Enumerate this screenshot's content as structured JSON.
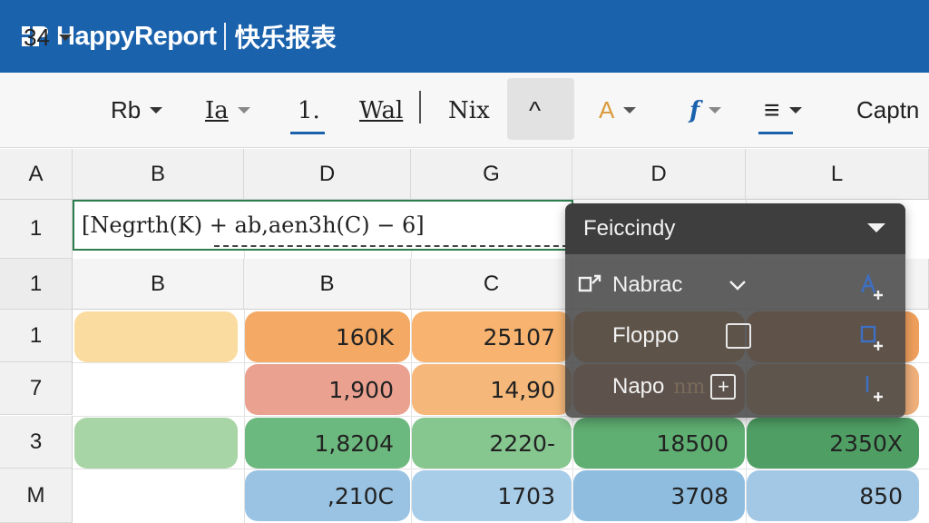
{
  "app": {
    "name": "HappyReport",
    "name_cn": "快乐报表"
  },
  "toolbar": {
    "font_size": "34",
    "font_name": "Rb",
    "style_a": "Ia",
    "style_b": "1.",
    "style_c": "Wal",
    "style_d": "Nix",
    "style_e": "^",
    "text_color": "A",
    "function": "f",
    "align": "≡",
    "caption": "Captn"
  },
  "columns": [
    "A",
    "B",
    "D",
    "G",
    "D",
    "L"
  ],
  "formula_row": {
    "row_label": "1",
    "formula": "[Negrth(K)  + ab,aen3h(C) − 6]"
  },
  "sub_header": {
    "row_label": "1",
    "labels": [
      "B",
      "B",
      "C"
    ]
  },
  "rows": [
    {
      "label": "1",
      "cells": [
        "",
        "160K",
        "25107",
        "",
        ""
      ]
    },
    {
      "label": "7",
      "cells": [
        "",
        "1,900",
        "14,90",
        "",
        ""
      ]
    },
    {
      "label": "3",
      "cells": [
        "",
        "1,8204",
        "2220-",
        "18500",
        "2350X"
      ]
    },
    {
      "label": "M",
      "cells": [
        "",
        ",210C",
        "1703",
        "3708",
        "850"
      ]
    }
  ],
  "dropdown": {
    "selected": "Feiccindy",
    "items": [
      {
        "label": "Nabrac"
      },
      {
        "label": "Floppo"
      },
      {
        "label": "Napo"
      }
    ],
    "background_text": "nm"
  },
  "colors": {
    "brand": "#1b62ad",
    "cell_yellow": "#fbdca0",
    "cell_orange": "#f4a964",
    "cell_red": "#eaa190",
    "cell_green_light": "#a8d5a6",
    "cell_green": "#6cb97f",
    "cell_blue": "#9ac3e3"
  }
}
